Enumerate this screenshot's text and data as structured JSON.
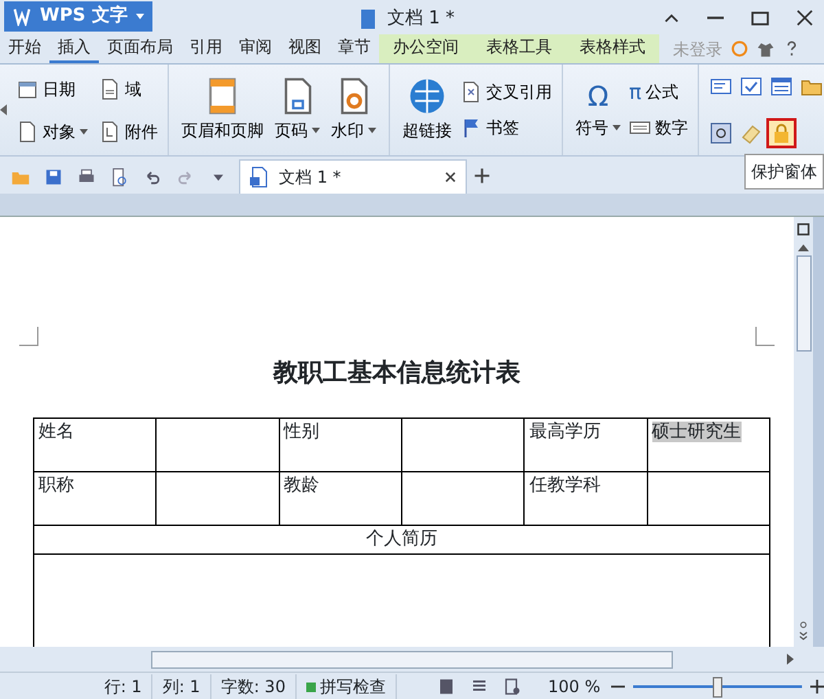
{
  "app_button": {
    "label": "WPS 文字"
  },
  "window": {
    "title": "文档 1 *"
  },
  "menu_tabs": [
    {
      "label": "开始",
      "selected": false,
      "contextual": false
    },
    {
      "label": "插入",
      "selected": true,
      "contextual": false
    },
    {
      "label": "页面布局",
      "selected": false,
      "contextual": false
    },
    {
      "label": "引用",
      "selected": false,
      "contextual": false
    },
    {
      "label": "审阅",
      "selected": false,
      "contextual": false
    },
    {
      "label": "视图",
      "selected": false,
      "contextual": false
    },
    {
      "label": "章节",
      "selected": false,
      "contextual": false
    },
    {
      "label": "办公空间",
      "selected": false,
      "contextual": true
    },
    {
      "label": "表格工具",
      "selected": false,
      "contextual": true
    },
    {
      "label": "表格样式",
      "selected": false,
      "contextual": true
    }
  ],
  "account": {
    "label": "未登录"
  },
  "ribbon": [
    {
      "kind": "small",
      "items": [
        {
          "label": "日期",
          "dropdown": false
        },
        {
          "label": "域",
          "dropdown": false
        },
        {
          "label": "对象",
          "dropdown": true
        },
        {
          "label": "附件",
          "dropdown": false
        }
      ]
    },
    {
      "kind": "large",
      "items": [
        {
          "label": "页眉和页脚",
          "dropdown": false
        },
        {
          "label": "页码",
          "dropdown": true
        },
        {
          "label": "水印",
          "dropdown": true
        }
      ]
    },
    {
      "kind": "mixed",
      "items": [
        {
          "label": "超链接",
          "dropdown": false
        },
        {
          "label": "交叉引用",
          "dropdown": false
        },
        {
          "label": "书签",
          "dropdown": false
        }
      ]
    },
    {
      "kind": "mixed",
      "items": [
        {
          "label": "符号",
          "glyph": "Ω",
          "dropdown": true
        },
        {
          "label": "公式",
          "glyph": "π",
          "dropdown": false
        },
        {
          "label": "数字",
          "dropdown": false
        }
      ]
    },
    {
      "kind": "icons",
      "items": [
        {
          "highlighted": false
        },
        {
          "highlighted": false
        },
        {
          "highlighted": false
        },
        {
          "highlighted": false
        },
        {
          "highlighted": false
        },
        {
          "highlighted": false
        },
        {
          "highlighted": true
        }
      ]
    }
  ],
  "tooltip": {
    "text": "保护窗体"
  },
  "document_tab": {
    "label": "文档 1 *"
  },
  "document": {
    "title": "教职工基本信息统计表",
    "rows": [
      {
        "kind": "fields",
        "cells": [
          {
            "text": "姓名",
            "highlighted": false
          },
          {
            "highlighted": false
          },
          {
            "text": "性别",
            "highlighted": false
          },
          {
            "highlighted": false
          },
          {
            "text": "最高学历",
            "highlighted": false
          },
          {
            "text": "硕士研究生",
            "highlighted": true
          }
        ]
      },
      {
        "kind": "fields",
        "cells": [
          {
            "text": "职称",
            "highlighted": false
          },
          {
            "highlighted": false
          },
          {
            "text": "教龄",
            "highlighted": false
          },
          {
            "highlighted": false
          },
          {
            "text": "任教学科",
            "highlighted": false
          },
          {
            "highlighted": false
          }
        ]
      },
      {
        "kind": "section",
        "text": "个人简历"
      }
    ]
  },
  "status_bar": {
    "items": [
      "行: 1",
      "列: 1",
      "字数: 30"
    ],
    "spell_check": "拼写检查",
    "zoom": "100 %",
    "zoom_level": {
      "level": 0.5
    }
  }
}
